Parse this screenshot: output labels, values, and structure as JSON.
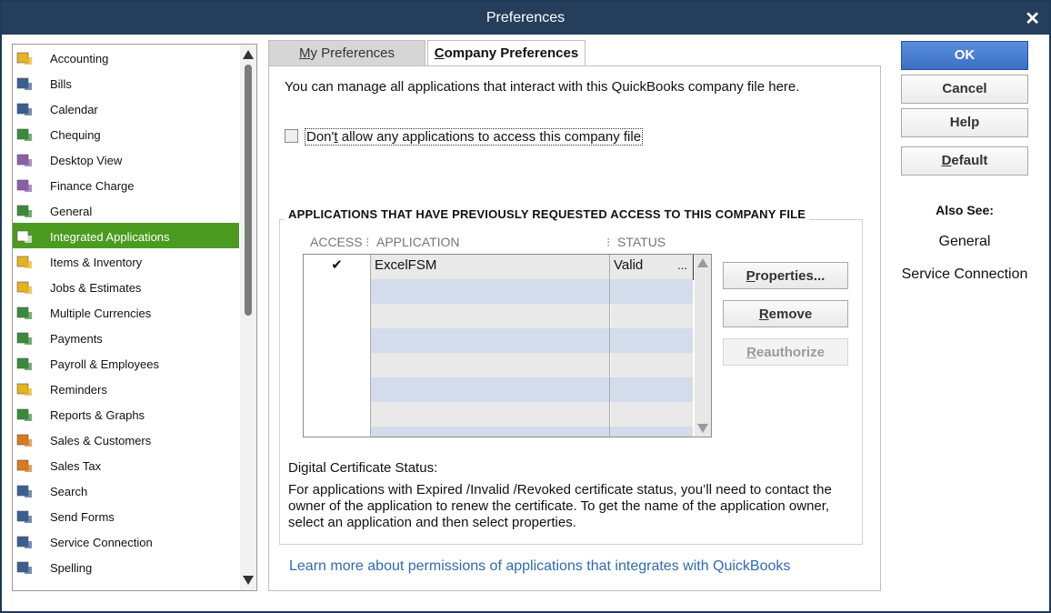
{
  "window": {
    "title": "Preferences",
    "close_label": "✕"
  },
  "sidebar": {
    "items": [
      {
        "label": "Accounting",
        "icon": "accounting-icon",
        "color": "#e6b31e"
      },
      {
        "label": "Bills",
        "icon": "bills-icon",
        "color": "#3a5f8f"
      },
      {
        "label": "Calendar",
        "icon": "calendar-icon",
        "color": "#3a5f8f"
      },
      {
        "label": "Chequing",
        "icon": "chequing-icon",
        "color": "#3b8a3b"
      },
      {
        "label": "Desktop View",
        "icon": "desktop-view-icon",
        "color": "#8a5fa8"
      },
      {
        "label": "Finance Charge",
        "icon": "finance-charge-icon",
        "color": "#8a5fa8"
      },
      {
        "label": "General",
        "icon": "general-icon",
        "color": "#3b8a3b"
      },
      {
        "label": "Integrated Applications",
        "icon": "integrated-apps-icon",
        "color": "#ffffff",
        "selected": true
      },
      {
        "label": "Items & Inventory",
        "icon": "items-inventory-icon",
        "color": "#e6b31e"
      },
      {
        "label": "Jobs & Estimates",
        "icon": "jobs-estimates-icon",
        "color": "#e6b31e"
      },
      {
        "label": "Multiple Currencies",
        "icon": "multiple-currencies-icon",
        "color": "#3b8a3b"
      },
      {
        "label": "Payments",
        "icon": "payments-icon",
        "color": "#3b8a3b"
      },
      {
        "label": "Payroll & Employees",
        "icon": "payroll-employees-icon",
        "color": "#3b8a3b"
      },
      {
        "label": "Reminders",
        "icon": "reminders-icon",
        "color": "#e6b31e"
      },
      {
        "label": "Reports & Graphs",
        "icon": "reports-graphs-icon",
        "color": "#3b8a3b"
      },
      {
        "label": "Sales & Customers",
        "icon": "sales-customers-icon",
        "color": "#d87a1e"
      },
      {
        "label": "Sales Tax",
        "icon": "sales-tax-icon",
        "color": "#d87a1e"
      },
      {
        "label": "Search",
        "icon": "search-icon",
        "color": "#3a5f8f"
      },
      {
        "label": "Send Forms",
        "icon": "send-forms-icon",
        "color": "#3a5f8f"
      },
      {
        "label": "Service Connection",
        "icon": "service-connection-icon",
        "color": "#3a5f8f"
      },
      {
        "label": "Spelling",
        "icon": "spelling-icon",
        "color": "#3a5f8f"
      }
    ]
  },
  "tabs": {
    "my_prefix": "M",
    "my_rest": "y Preferences",
    "company_prefix": "C",
    "company_rest": "ompany Preferences"
  },
  "main": {
    "intro": "You can manage all applications that interact with this QuickBooks company file here.",
    "checkbox_pre": "Don'",
    "checkbox_u": "t",
    "checkbox_post": " allow any applications to access this company file",
    "checkbox_checked": false,
    "group_title": "APPLICATIONS THAT HAVE PREVIOUSLY REQUESTED ACCESS TO THIS COMPANY FILE",
    "columns": {
      "access": "ACCESS",
      "application": "APPLICATION",
      "status": "STATUS"
    },
    "rows": [
      {
        "access": "✔",
        "application": "ExcelFSM",
        "status": "Valid",
        "more": "..."
      }
    ],
    "buttons": {
      "properties_u": "P",
      "properties_rest": "roperties...",
      "remove_u": "R",
      "remove_rest": "emove",
      "reauth_u": "R",
      "reauth_rest": "eauthorize"
    },
    "dcs_label": "Digital Certificate Status:",
    "dcs_text": "For applications with Expired /Invalid /Revoked certificate status, you’ll need to contact the owner of the application to renew the certificate. To get the name of the application owner, select an application and then select properties.",
    "learn_more": "Learn more about permissions of applications that integrates with QuickBooks"
  },
  "right": {
    "ok": "OK",
    "cancel": "Cancel",
    "help": "Help",
    "default_u": "D",
    "default_rest": "efault",
    "also_see": "Also See:",
    "links": [
      "General",
      "Service Connection"
    ]
  },
  "colors": {
    "titlebar": "#243e5c",
    "selected": "#4a9b20",
    "ok": "#3a6fc4",
    "link": "#2e6bb5",
    "row_alt": "#d3dcea"
  }
}
